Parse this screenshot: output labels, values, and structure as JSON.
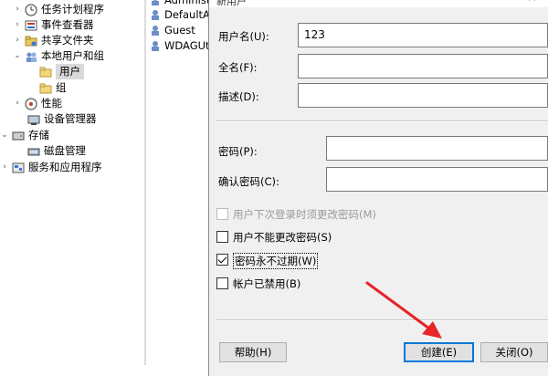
{
  "tree": {
    "items": [
      {
        "label": "任务计划程序",
        "icon": "task-scheduler-icon"
      },
      {
        "label": "事件查看器",
        "icon": "event-viewer-icon"
      },
      {
        "label": "共享文件夹",
        "icon": "shared-folder-icon"
      },
      {
        "label": "本地用户和组",
        "icon": "local-users-groups-icon"
      },
      {
        "label": "用户",
        "icon": "folder-icon"
      },
      {
        "label": "组",
        "icon": "folder-icon"
      },
      {
        "label": "性能",
        "icon": "performance-icon"
      },
      {
        "label": "设备管理器",
        "icon": "device-manager-icon"
      },
      {
        "label": "存储",
        "icon": "storage-icon"
      },
      {
        "label": "磁盘管理",
        "icon": "disk-management-icon"
      },
      {
        "label": "服务和应用程序",
        "icon": "services-apps-icon"
      }
    ]
  },
  "user_list": {
    "items": [
      "Administ",
      "DefaultAc",
      "Guest",
      "WDAGUti"
    ]
  },
  "dialog": {
    "title": "新用户",
    "close_glyph": "×",
    "username_label": "用户名(U):",
    "username_value": "123",
    "fullname_label": "全名(F):",
    "fullname_value": "",
    "description_label": "描述(D):",
    "description_value": "",
    "password_label": "密码(P):",
    "confirm_label": "确认密码(C):",
    "checkboxes": [
      {
        "label": "用户下次登录时须更改密码(M)",
        "checked": false,
        "disabled": true
      },
      {
        "label": "用户不能更改密码(S)",
        "checked": false,
        "disabled": false
      },
      {
        "label": "密码永不过期(W)",
        "checked": true,
        "disabled": false
      },
      {
        "label": "帐户已禁用(B)",
        "checked": false,
        "disabled": false
      }
    ],
    "buttons": {
      "help": "帮助(H)",
      "create": "创建(E)",
      "close": "关闭(O)"
    }
  },
  "annotation": {
    "arrow_color": "#e8232a"
  }
}
